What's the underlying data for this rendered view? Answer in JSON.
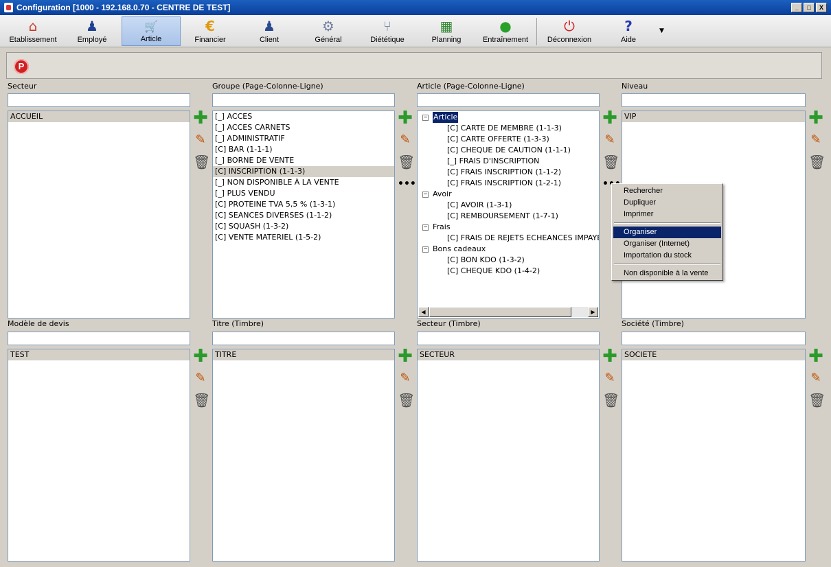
{
  "window": {
    "title": "Configuration [1000 - 192.168.0.70 - CENTRE DE TEST]",
    "min_glyph": "_",
    "max_glyph": "□",
    "close_glyph": "X"
  },
  "toolbar": {
    "items": [
      {
        "label": "Etablissement",
        "icon": "home-icon",
        "glyph": "⌂",
        "color": "#c83a2a"
      },
      {
        "label": "Employé",
        "icon": "employee-icon",
        "glyph": "♟",
        "color": "#1f3f90"
      },
      {
        "label": "Article",
        "icon": "cart-icon",
        "glyph": "🛒",
        "color": "#4a8a2a"
      },
      {
        "label": "Financier",
        "icon": "euro-icon",
        "glyph": "€",
        "color": "#e09a10"
      },
      {
        "label": "Client",
        "icon": "client-icon",
        "glyph": "♟",
        "color": "#2a4a90"
      },
      {
        "label": "Général",
        "icon": "gear-icon",
        "glyph": "⚙",
        "color": "#7080a0"
      },
      {
        "label": "Diététique",
        "icon": "cutlery-icon",
        "glyph": "⑂",
        "color": "#7a8aa0"
      },
      {
        "label": "Planning",
        "icon": "calendar-icon",
        "glyph": "▦",
        "color": "#3a8a3a"
      },
      {
        "label": "Entraînement",
        "icon": "runner-icon",
        "glyph": "●",
        "color": "#2aa02a"
      },
      {
        "label": "Déconnexion",
        "icon": "power-icon",
        "glyph": "⏻",
        "color": "#d02020"
      },
      {
        "label": "Aide",
        "icon": "help-icon",
        "glyph": "?",
        "color": "#2a3ab0"
      }
    ],
    "more_glyph": "▼"
  },
  "subbar": {
    "p_glyph": "P"
  },
  "panels": {
    "secteur": {
      "label": "Secteur",
      "filter": "",
      "items": [
        "ACCUEIL"
      ]
    },
    "groupe": {
      "label": "Groupe (Page-Colonne-Ligne)",
      "filter": "",
      "items": [
        "[_] ACCES",
        "[_] ACCES CARNETS",
        "[_] ADMINISTRATIF",
        "[C] BAR (1-1-1)",
        "[_] BORNE DE VENTE",
        "[C] INSCRIPTION (1-1-3)",
        "[_] NON DISPONIBLE À LA VENTE",
        "[_] PLUS VENDU",
        "[C] PROTEINE TVA 5,5 % (1-3-1)",
        "[C] SEANCES DIVERSES (1-1-2)",
        "[C] SQUASH (1-3-2)",
        "[C] VENTE MATERIEL (1-5-2)"
      ]
    },
    "article": {
      "label": "Article (Page-Colonne-Ligne)",
      "filter": "",
      "tree": {
        "root": "Article",
        "root_items": [
          "[C] CARTE DE MEMBRE (1-1-3)",
          "[C] CARTE OFFERTE (1-3-3)",
          "[C] CHEQUE DE CAUTION (1-1-1)",
          "[_] FRAIS D'INSCRIPTION",
          "[C] FRAIS INSCRIPTION (1-1-2)",
          "[C] FRAIS INSCRIPTION (1-2-1)"
        ],
        "avoir": "Avoir",
        "avoir_items": [
          "[C] AVOIR (1-3-1)",
          "[C] REMBOURSEMENT (1-7-1)"
        ],
        "frais": "Frais",
        "frais_items": [
          "[C] FRAIS DE REJETS ECHEANCES IMPAYER ("
        ],
        "bons": "Bons cadeaux",
        "bons_items": [
          "[C] BON KDO (1-3-2)",
          "[C] CHEQUE KDO (1-4-2)"
        ]
      }
    },
    "niveau": {
      "label": "Niveau",
      "filter": "",
      "items": [
        "VIP"
      ]
    },
    "modele": {
      "label": "Modèle de devis",
      "filter": "",
      "items": [
        "TEST"
      ]
    },
    "titre": {
      "label": "Titre (Timbre)",
      "filter": "",
      "items": [
        "TITRE"
      ]
    },
    "secteur_timbre": {
      "label": "Secteur (Timbre)",
      "filter": "",
      "items": [
        "SECTEUR"
      ]
    },
    "societe": {
      "label": "Société (Timbre)",
      "filter": "",
      "items": [
        "SOCIETE"
      ]
    }
  },
  "actions": {
    "add": "✚",
    "edit": "✎",
    "delete": "🗑",
    "more": "•••"
  },
  "context_menu": [
    "Rechercher",
    "Dupliquer",
    "Imprimer",
    "Organiser",
    "Organiser (Internet)",
    "Importation du stock",
    "Non disponible à la vente"
  ],
  "scroll": {
    "left": "◀",
    "right": "▶"
  },
  "tree_glyphs": {
    "expanded": "−"
  }
}
